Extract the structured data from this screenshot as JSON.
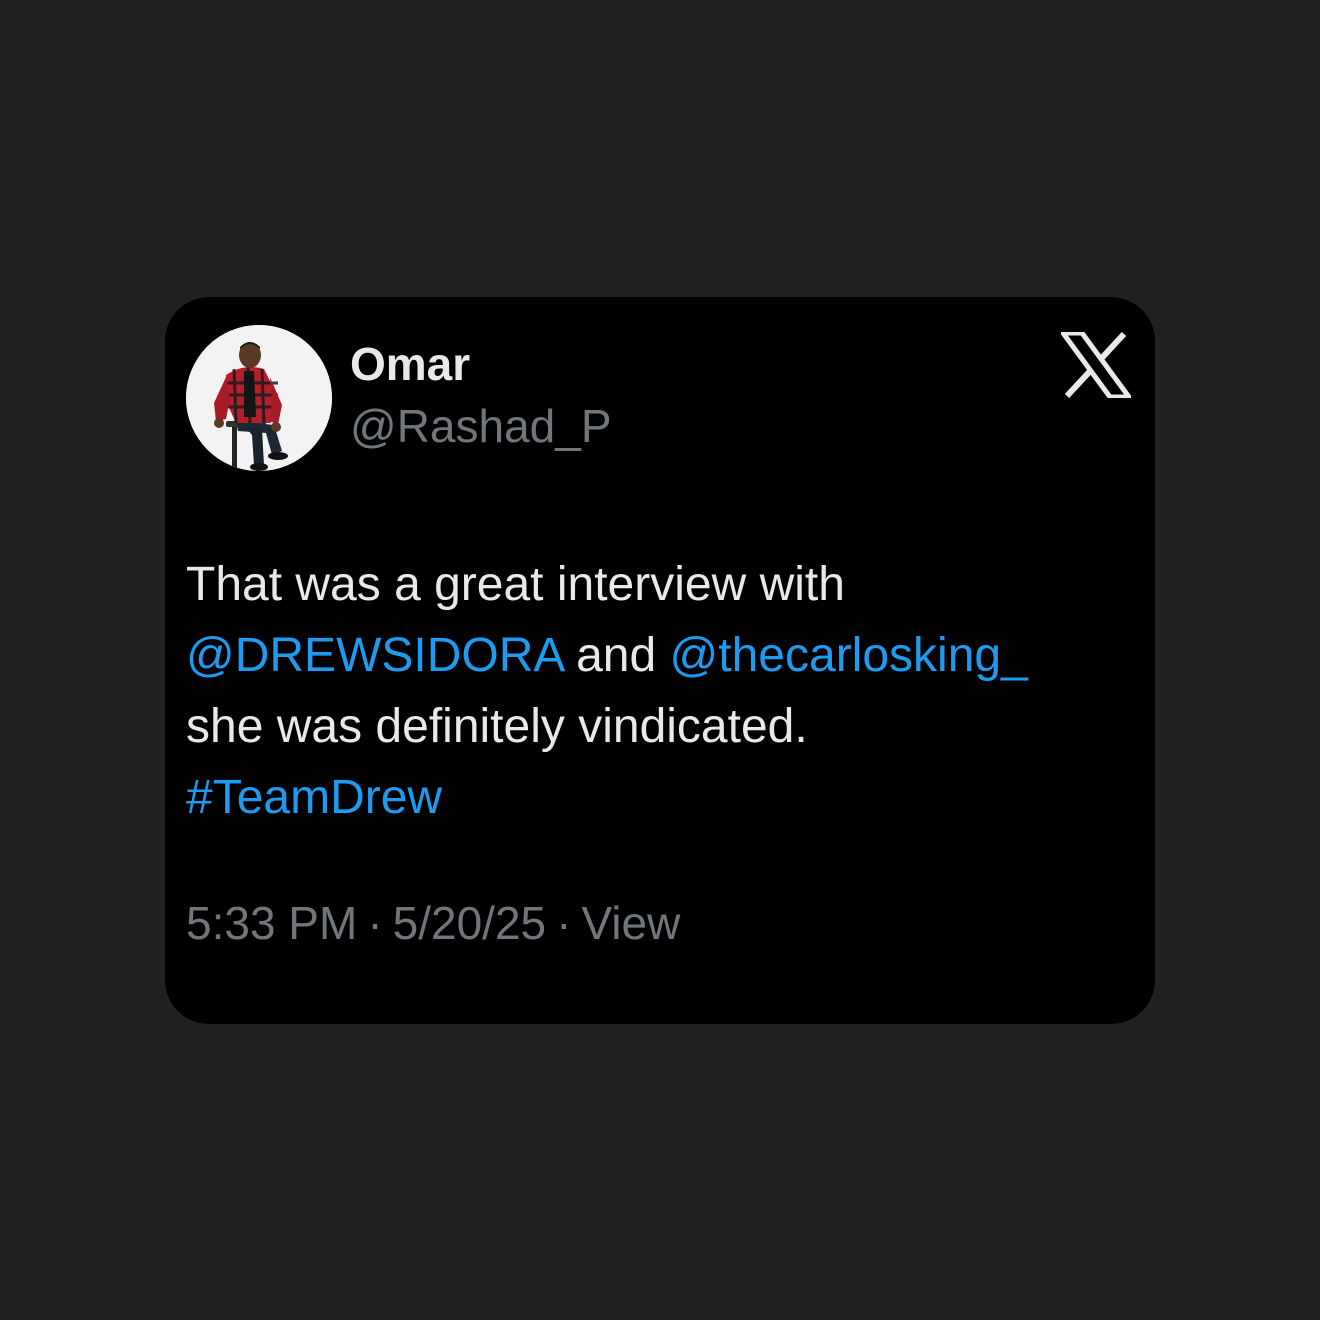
{
  "tweet": {
    "author": {
      "display_name": "Omar",
      "handle": "@Rashad_P"
    },
    "brand_icon": "x-logo-icon",
    "text": {
      "line1": "That was a great interview with",
      "mention1": "@DREWSIDORA",
      "and_word": "and",
      "mention2": "@thecarlosking_",
      "line3": "she was definitely vindicated.",
      "hashtag": "#TeamDrew"
    },
    "meta": {
      "time": "5:33 PM",
      "date": "5/20/25",
      "views_label": "View",
      "separator": "·"
    }
  },
  "colors": {
    "page_background": "#212121",
    "card_background": "#000000",
    "primary_text": "#e7e9ea",
    "secondary_text": "#71767b",
    "link": "#1d9bf0"
  }
}
